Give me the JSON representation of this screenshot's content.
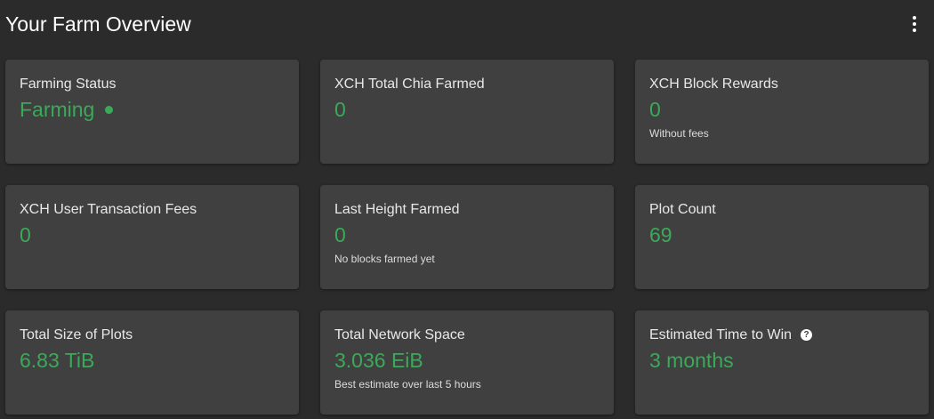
{
  "header": {
    "title": "Your Farm Overview",
    "menu_icon": "more-vertical-icon"
  },
  "colors": {
    "background": "#2b2b2b",
    "card": "#404040",
    "accent_green": "#3aaa59",
    "title_text": "#e8e8e8"
  },
  "cards": {
    "farming_status": {
      "title": "Farming Status",
      "value": "Farming",
      "indicator": "green-status-dot"
    },
    "total_chia_farmed": {
      "title": "XCH Total Chia Farmed",
      "value": "0"
    },
    "block_rewards": {
      "title": "XCH Block Rewards",
      "value": "0",
      "subtext": "Without fees"
    },
    "user_transaction_fees": {
      "title": "XCH User Transaction Fees",
      "value": "0"
    },
    "last_height_farmed": {
      "title": "Last Height Farmed",
      "value": "0",
      "subtext": "No blocks farmed yet"
    },
    "plot_count": {
      "title": "Plot Count",
      "value": "69"
    },
    "total_size_of_plots": {
      "title": "Total Size of Plots",
      "value": "6.83 TiB"
    },
    "total_network_space": {
      "title": "Total Network Space",
      "value": "3.036 EiB",
      "subtext": "Best estimate over last 5 hours"
    },
    "estimated_time_to_win": {
      "title": "Estimated Time to Win",
      "value": "3 months",
      "help_icon": "help-circle-icon"
    }
  }
}
